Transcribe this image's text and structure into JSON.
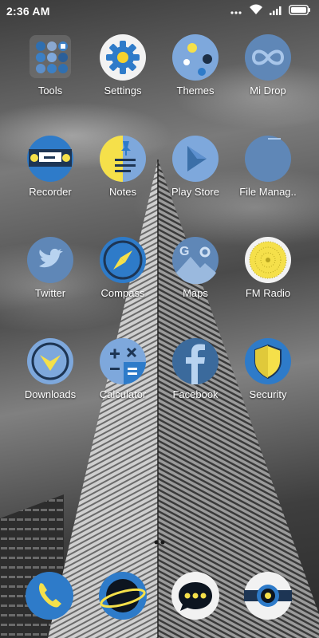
{
  "status_bar": {
    "time": "2:36 AM",
    "icons": [
      "more-dots-icon",
      "wifi-icon",
      "signal-icon",
      "battery-icon"
    ]
  },
  "home_apps": [
    {
      "label": "Tools",
      "icon": "tools-folder-icon"
    },
    {
      "label": "Settings",
      "icon": "gear-icon"
    },
    {
      "label": "Themes",
      "icon": "themes-icon"
    },
    {
      "label": "Mi Drop",
      "icon": "infinity-icon"
    },
    {
      "label": "Recorder",
      "icon": "recorder-icon"
    },
    {
      "label": "Notes",
      "icon": "notes-icon"
    },
    {
      "label": "Play Store",
      "icon": "play-store-icon"
    },
    {
      "label": "File Manag..",
      "icon": "folder-icon"
    },
    {
      "label": "Twitter",
      "icon": "twitter-bird-icon"
    },
    {
      "label": "Compass",
      "icon": "compass-icon"
    },
    {
      "label": "Maps",
      "icon": "maps-icon"
    },
    {
      "label": "FM Radio",
      "icon": "radio-icon"
    },
    {
      "label": "Downloads",
      "icon": "download-arrow-icon"
    },
    {
      "label": "Calculator",
      "icon": "calculator-icon"
    },
    {
      "label": "Facebook",
      "icon": "facebook-icon"
    },
    {
      "label": "Security",
      "icon": "shield-icon"
    }
  ],
  "dock_apps": [
    {
      "icon": "phone-icon"
    },
    {
      "icon": "planet-browser-icon"
    },
    {
      "icon": "messages-icon"
    },
    {
      "icon": "camera-icon"
    }
  ],
  "colors": {
    "icon_blue": "#3b7fc4",
    "icon_light_blue": "#7ea8dc",
    "icon_yellow": "#f5e04a",
    "icon_dark": "#1f3a5c"
  }
}
